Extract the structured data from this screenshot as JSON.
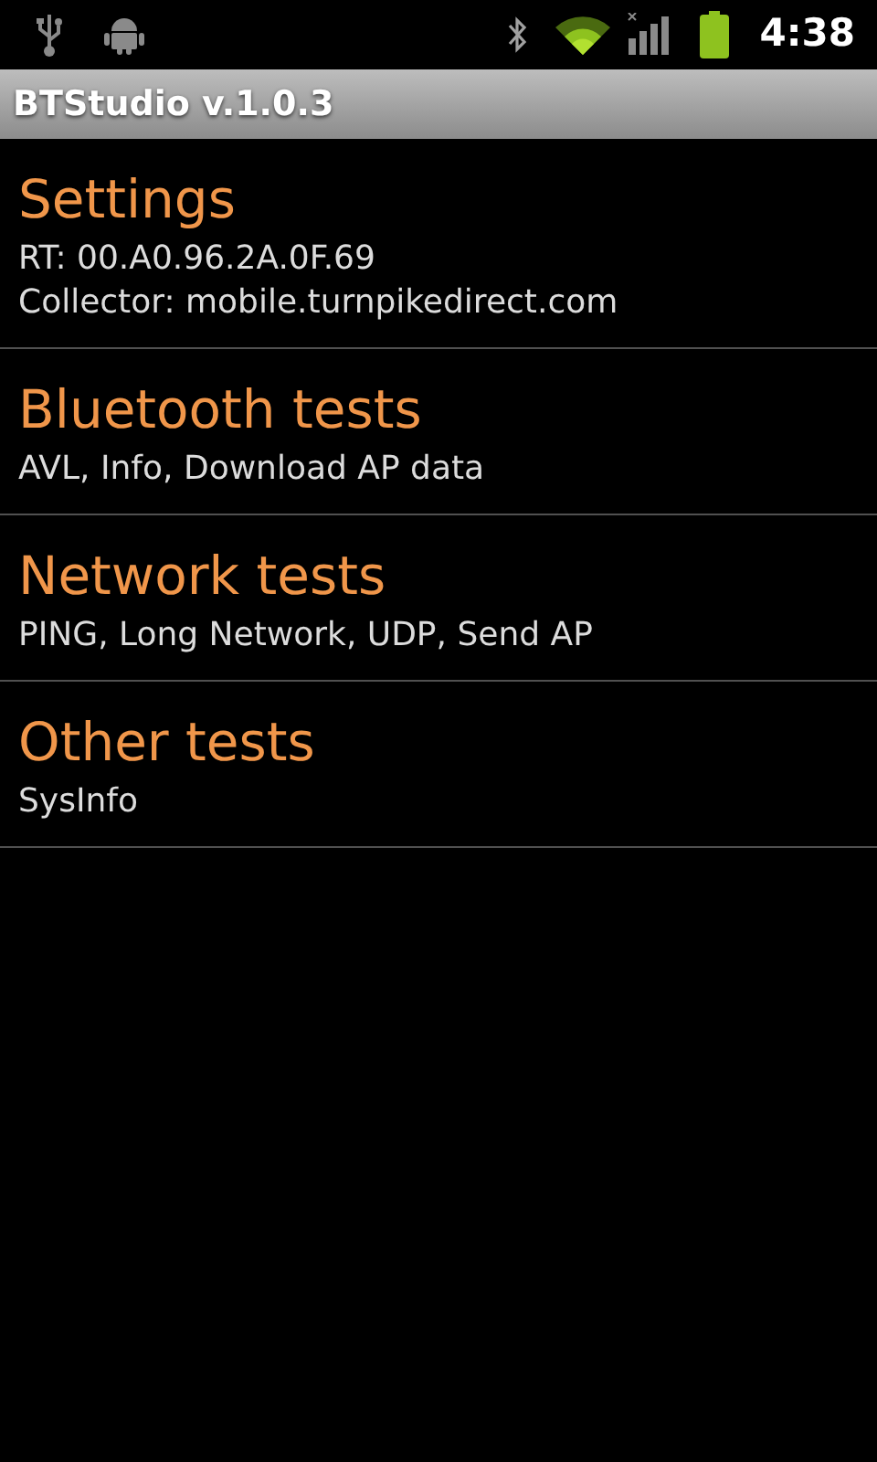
{
  "status_bar": {
    "time": "4:38"
  },
  "app_bar": {
    "title": "BTStudio v.1.0.3"
  },
  "items": [
    {
      "title": "Settings",
      "lines": [
        "RT: 00.A0.96.2A.0F.69",
        "Collector: mobile.turnpikedirect.com"
      ]
    },
    {
      "title": "Bluetooth tests",
      "lines": [
        "AVL, Info, Download AP data"
      ]
    },
    {
      "title": "Network tests",
      "lines": [
        "PING, Long Network, UDP, Send AP"
      ]
    },
    {
      "title": "Other tests",
      "lines": [
        "SysInfo"
      ]
    }
  ]
}
